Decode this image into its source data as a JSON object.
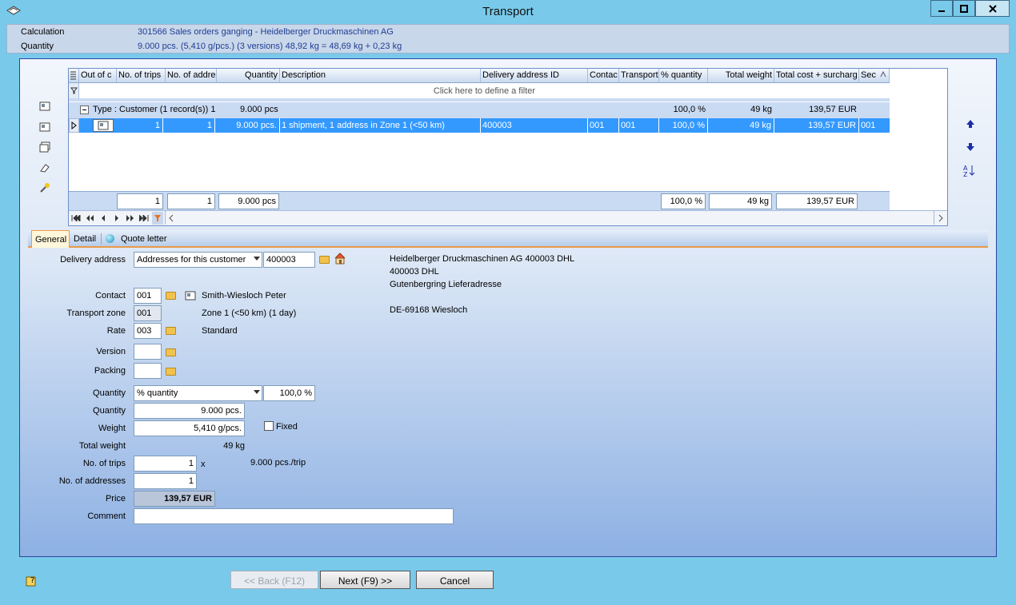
{
  "window": {
    "title": "Transport"
  },
  "info": {
    "calculation_label": "Calculation",
    "calculation_value": "301566 Sales orders ganging - Heidelberger Druckmaschinen AG",
    "quantity_label": "Quantity",
    "quantity_value": "9.000 pcs. (5,410 g/pcs.)  (3 versions) 48,92 kg = 48,69 kg + 0,23 kg"
  },
  "grid": {
    "columns": [
      "Out of c",
      "No. of trips",
      "No. of addre",
      "Quantity",
      "Description",
      "Delivery address ID",
      "Contac",
      "Transport",
      "% quantity",
      "Total weight",
      "Total cost + surcharg",
      "Sec"
    ],
    "filter_hint": "Click here to define a filter",
    "group_label": "Type : Customer (1 record(s)) 1",
    "group_quantity": "9.000 pcs",
    "group_pct": "100,0 %",
    "group_weight": "49 kg",
    "group_cost": "139,57 EUR",
    "row": {
      "trips": "1",
      "addresses": "1",
      "quantity": "9.000 pcs.",
      "description": "1 shipment, 1 address in Zone 1 (<50 km)",
      "delivery_address_id": "400003",
      "contact": "001",
      "transport": "001",
      "pct_quantity": "100,0 %",
      "total_weight": "49 kg",
      "total_cost": "139,57 EUR",
      "sec": "001"
    },
    "footer": {
      "trips": "1",
      "addresses": "1",
      "quantity": "9.000 pcs",
      "pct": "100,0 %",
      "weight": "49 kg",
      "cost": "139,57 EUR"
    }
  },
  "tabs": [
    "General",
    "Detail",
    "Quote letter"
  ],
  "form": {
    "delivery_address_label": "Delivery address",
    "delivery_address_select": "Addresses for this customer",
    "delivery_address_id": "400003",
    "address_lines": [
      "Heidelberger Druckmaschinen AG 400003 DHL",
      "400003 DHL",
      "Gutenbergring Lieferadresse",
      "",
      "DE-69168 Wiesloch"
    ],
    "contact_label": "Contact",
    "contact_value": "001",
    "contact_name": "Smith-Wiesloch Peter",
    "transport_zone_label": "Transport zone",
    "transport_zone_value": "001",
    "transport_zone_text": "Zone 1 (<50 km) (1 day)",
    "rate_label": "Rate",
    "rate_value": "003",
    "rate_text": "Standard",
    "version_label": "Version",
    "version_value": "",
    "packing_label": "Packing",
    "packing_value": "",
    "quantity_label": "Quantity",
    "quantity_select": "% quantity",
    "quantity_pct": "100,0 %",
    "quantity2_label": "Quantity",
    "quantity2_value": "9.000 pcs.",
    "weight_label": "Weight",
    "weight_value": "5,410 g/pcs.",
    "fixed_label": "Fixed",
    "total_weight_label": "Total weight",
    "total_weight_value": "49 kg",
    "trips_label": "No. of trips",
    "trips_value": "1",
    "trips_x": "x",
    "trips_per": "9.000 pcs./trip",
    "addresses_label": "No. of addresses",
    "addresses_value": "1",
    "price_label": "Price",
    "price_value": "139,57 EUR",
    "comment_label": "Comment",
    "comment_value": ""
  },
  "buttons": {
    "back": "<< Back (F12)",
    "next": "Next (F9) >>",
    "cancel": "Cancel"
  },
  "colors": {
    "selection": "#3399ff",
    "titlebar": "#79c9ea",
    "group_row": "#c9daf3"
  }
}
